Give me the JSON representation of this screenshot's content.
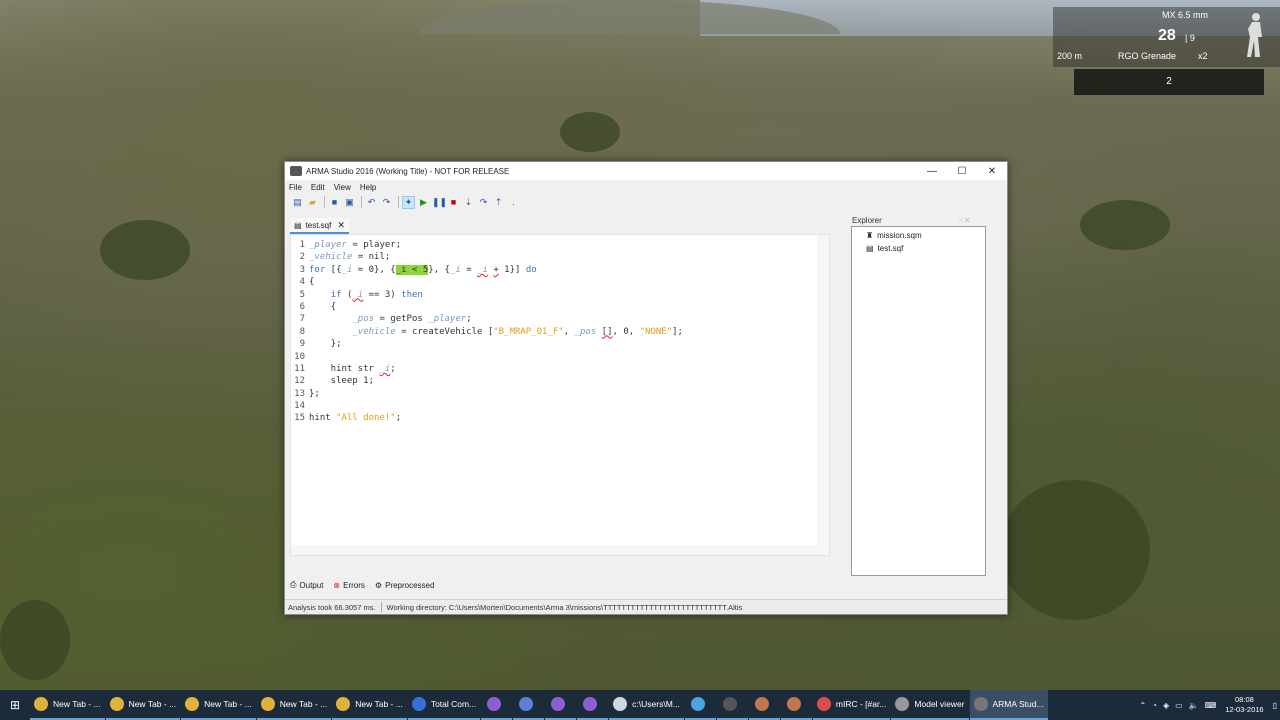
{
  "hud": {
    "weapon": "MX 6.5 mm",
    "ammo": "28",
    "mags": "| 9",
    "range": "200 m",
    "grenade": "RGO Grenade",
    "grenade_count": "x2",
    "secondary": "2"
  },
  "window": {
    "title": "ARMA Studio 2016 (Working Title) - NOT FOR RELEASE",
    "minimize": "—",
    "maximize": "☐",
    "close": "✕"
  },
  "menu": [
    "File",
    "Edit",
    "View",
    "Help"
  ],
  "toolbar_icons": [
    "new-file-icon",
    "open-folder-icon",
    "save-icon",
    "save-all-icon",
    "undo-icon",
    "redo-icon",
    "breakpoint-icon",
    "run-icon",
    "pause-icon",
    "stop-icon",
    "step-into-icon",
    "step-over-icon",
    "step-out-icon"
  ],
  "editor": {
    "tab_label": "test.sqf",
    "line_numbers": [
      "1",
      "2",
      "3",
      "4",
      "5",
      "6",
      "7",
      "8",
      "9",
      "10",
      "11",
      "12",
      "13",
      "14",
      "15"
    ]
  },
  "explorer": {
    "title": "Explorer",
    "items": [
      {
        "label": "mission.sqm",
        "icon": "mission-file-icon"
      },
      {
        "label": "test.sqf",
        "icon": "script-file-icon"
      }
    ]
  },
  "bottom_tabs": [
    {
      "label": "Output",
      "icon": "output-icon"
    },
    {
      "label": "Errors",
      "icon": "errors-icon"
    },
    {
      "label": "Preprocessed",
      "icon": "preprocessed-icon"
    }
  ],
  "status": {
    "analysis": "Analysis took 66.3057 ms.",
    "working_directory": "Working directory: C:\\Users\\Morten\\Documents\\Arma 3\\missions\\TTTTTTTTTTTTTTTTTTTTTTTTTTT.Altis"
  },
  "taskbar": {
    "tasks": [
      {
        "label": "New Tab - ...",
        "icon": "chrome-icon",
        "color": "#e0b23a"
      },
      {
        "label": "New Tab - ...",
        "icon": "chrome-icon",
        "color": "#e0b23a"
      },
      {
        "label": "New Tab - ...",
        "icon": "chrome-icon",
        "color": "#e0b23a"
      },
      {
        "label": "New Tab - ...",
        "icon": "chrome-icon",
        "color": "#e0b23a"
      },
      {
        "label": "New Tab - ...",
        "icon": "chrome-icon",
        "color": "#e0b23a"
      },
      {
        "label": "Total Com...",
        "icon": "total-commander-icon",
        "color": "#3b6fd8"
      },
      {
        "label": "",
        "icon": "visual-studio-icon",
        "color": "#8b5fd1"
      },
      {
        "label": "",
        "icon": "visual-studio-icon",
        "color": "#5a7fd4"
      },
      {
        "label": "",
        "icon": "visual-studio-icon",
        "color": "#8b5fd1"
      },
      {
        "label": "",
        "icon": "visual-studio-icon",
        "color": "#8b5fd1"
      },
      {
        "label": "c:\\Users\\M...",
        "icon": "notepad-icon",
        "color": "#cfd8e0"
      },
      {
        "label": "",
        "icon": "window-icon",
        "color": "#4aa3e0"
      },
      {
        "label": "",
        "icon": "app-icon",
        "color": "#555555"
      },
      {
        "label": "",
        "icon": "app-icon",
        "color": "#c0784e"
      },
      {
        "label": "",
        "icon": "app-icon",
        "color": "#c0784e"
      },
      {
        "label": "mIRC - [#ar...",
        "icon": "mirc-icon",
        "color": "#d94f4f"
      },
      {
        "label": "Model viewer",
        "icon": "model-viewer-icon",
        "color": "#999999"
      },
      {
        "label": "ARMA Stud...",
        "icon": "arma-studio-icon",
        "color": "#777777"
      }
    ],
    "time": "08:08",
    "date": "12-03-2016"
  }
}
